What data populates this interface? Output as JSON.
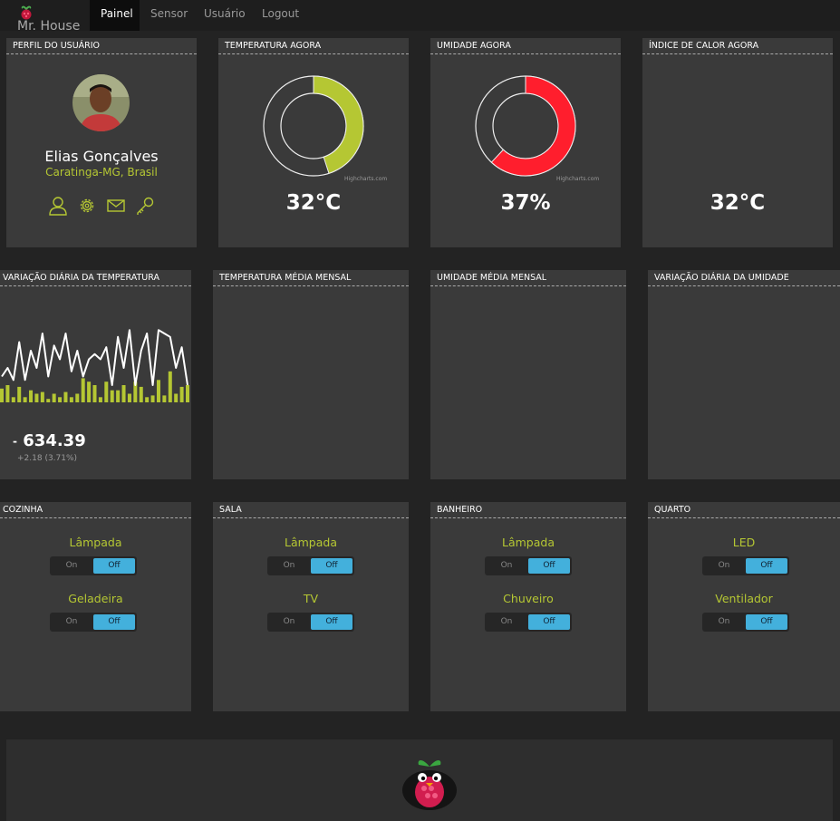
{
  "app": {
    "brand": "Mr. House"
  },
  "nav": [
    {
      "label": "Painel",
      "active": true
    },
    {
      "label": "Sensor",
      "active": false
    },
    {
      "label": "Usuário",
      "active": false
    },
    {
      "label": "Logout",
      "active": false
    }
  ],
  "profile": {
    "title": "PERFIL DO USUÁRIO",
    "name": "Elias Gonçalves",
    "location": "Caratinga-MG, Brasil",
    "icons": [
      "user-icon",
      "gear-icon",
      "envelope-icon",
      "key-icon"
    ]
  },
  "temperature_now": {
    "title": "TEMPERATURA AGORA",
    "value": "32°C",
    "gauge_fraction": 0.45,
    "color": "#b5c733",
    "credit": "Highcharts.com"
  },
  "humidity_now": {
    "title": "UMIDADE AGORA",
    "value": "37%",
    "gauge_fraction": 0.62,
    "color": "#ff1e2d",
    "credit": "Highcharts.com"
  },
  "heat_index_now": {
    "title": "ÍNDICE DE CALOR AGORA",
    "value": "32°C"
  },
  "daily_temperature": {
    "title": "VARIAÇÃO DIÁRIA DA TEMPERATURA",
    "value": "634.39",
    "change": "+2.18 (3.71%)"
  },
  "monthly_temperature": {
    "title": "TEMPERATURA MÉDIA MENSAL"
  },
  "monthly_humidity": {
    "title": "UMIDADE MÉDIA MENSAL"
  },
  "daily_humidity": {
    "title": "VARIAÇÃO DIÁRIA DA UMIDADE"
  },
  "chart_data": {
    "type": "line",
    "series": [
      {
        "type": "line",
        "values": [
          15,
          20,
          13,
          35,
          13,
          30,
          20,
          40,
          15,
          33,
          25,
          40,
          18,
          30,
          15,
          25,
          28,
          25,
          32,
          10,
          38,
          20,
          42,
          10,
          30,
          40,
          10,
          42,
          40,
          38,
          20,
          32,
          10
        ]
      },
      {
        "type": "column",
        "values": [
          8,
          10,
          3,
          9,
          3,
          7,
          5,
          6,
          2,
          5,
          3,
          6,
          3,
          5,
          14,
          12,
          10,
          3,
          12,
          7,
          7,
          10,
          5,
          12,
          9,
          3,
          4,
          13,
          4,
          18,
          5,
          9,
          10
        ]
      }
    ],
    "colors": {
      "line": "#ffffff",
      "columns": "#b5c733"
    }
  },
  "rooms": [
    {
      "title": "COZINHA",
      "devices": [
        {
          "name": "Lâmpada",
          "on": "On",
          "off": "Off",
          "state": "off"
        },
        {
          "name": "Geladeira",
          "on": "On",
          "off": "Off",
          "state": "off"
        }
      ]
    },
    {
      "title": "SALA",
      "devices": [
        {
          "name": "Lâmpada",
          "on": "On",
          "off": "Off",
          "state": "off"
        },
        {
          "name": "TV",
          "on": "On",
          "off": "Off",
          "state": "off"
        }
      ]
    },
    {
      "title": "BANHEIRO",
      "devices": [
        {
          "name": "Lâmpada",
          "on": "On",
          "off": "Off",
          "state": "off"
        },
        {
          "name": "Chuveiro",
          "on": "On",
          "off": "Off",
          "state": "off"
        }
      ]
    },
    {
      "title": "QUARTO",
      "devices": [
        {
          "name": "LED",
          "on": "On",
          "off": "Off",
          "state": "off"
        },
        {
          "name": "Ventilador",
          "on": "On",
          "off": "Off",
          "state": "off"
        }
      ]
    }
  ],
  "colors": {
    "accent": "#b5c733",
    "toggle_off": "#43b0dc",
    "panel": "#3a3a3a",
    "background": "#232323"
  }
}
